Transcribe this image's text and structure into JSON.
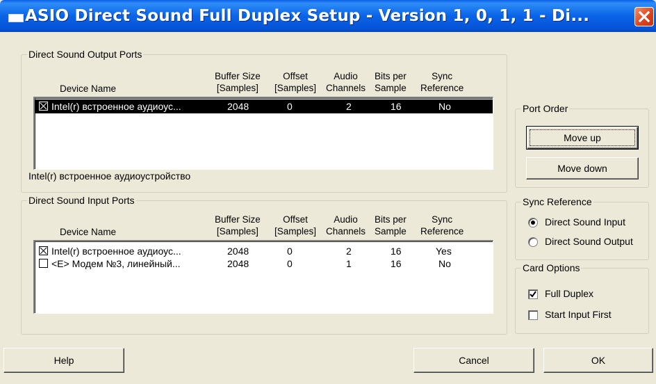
{
  "window": {
    "title": "ASIO Direct Sound Full Duplex Setup   -  Version 1, 0, 1, 1  -  Di..."
  },
  "columns": {
    "device_name": "Device Name",
    "buffer_size": [
      "Buffer Size",
      "[Samples]"
    ],
    "offset": [
      "Offset",
      "[Samples]"
    ],
    "audio_channels": [
      "Audio",
      "Channels"
    ],
    "bits_per_sample": [
      "Bits per",
      "Sample"
    ],
    "sync_reference": [
      "Sync",
      "Reference"
    ]
  },
  "output_ports": {
    "label": "Direct Sound Output Ports",
    "rows": [
      {
        "checked": true,
        "selected": true,
        "device": "Intel(r) встроенное аудиоус...",
        "buffer": "2048",
        "offset": "0",
        "channels": "2",
        "bits": "16",
        "sync": "No"
      }
    ],
    "device_caption": "Intel(r) встроенное аудиоустройство"
  },
  "input_ports": {
    "label": "Direct Sound Input Ports",
    "rows": [
      {
        "checked": true,
        "selected": false,
        "device": "Intel(r) встроенное аудиоус...",
        "buffer": "2048",
        "offset": "0",
        "channels": "2",
        "bits": "16",
        "sync": "Yes"
      },
      {
        "checked": false,
        "selected": false,
        "device": "<E> Модем №3, линейный...",
        "buffer": "2048",
        "offset": "0",
        "channels": "1",
        "bits": "16",
        "sync": "No"
      }
    ]
  },
  "port_order": {
    "label": "Port Order",
    "move_up": "Move up",
    "move_down": "Move down"
  },
  "sync_reference": {
    "label": "Sync Reference",
    "options": [
      {
        "label": "Direct Sound Input",
        "selected": true
      },
      {
        "label": "Direct Sound Output",
        "selected": false
      }
    ]
  },
  "card_options": {
    "label": "Card Options",
    "full_duplex": {
      "label": "Full Duplex",
      "checked": true
    },
    "start_input_first": {
      "label": "Start Input First",
      "checked": false
    }
  },
  "buttons": {
    "help": "Help",
    "cancel": "Cancel",
    "ok": "OK"
  },
  "colors": {
    "title_bar": "#0a5ee9",
    "close_button": "#d9421c",
    "dialog_bg": "#ece9d8",
    "selection": "#000000"
  },
  "icons": {
    "system_menu": "window-icon",
    "close": "close-icon"
  }
}
